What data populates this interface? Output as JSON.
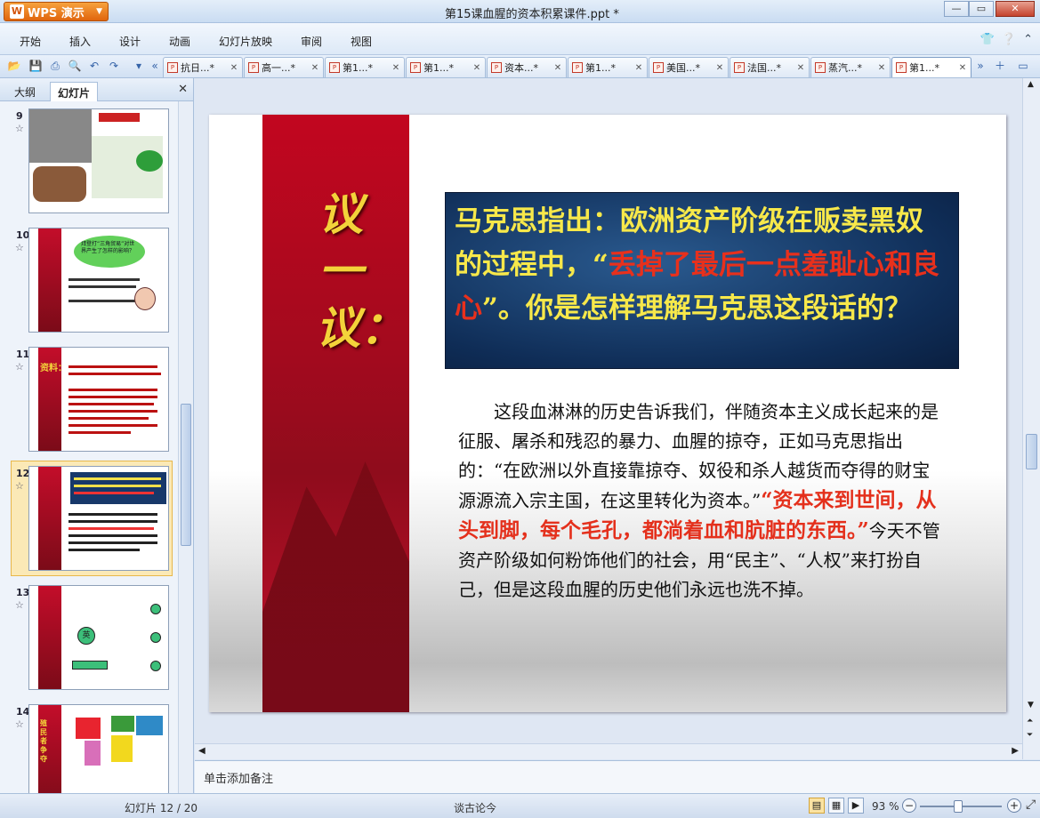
{
  "app": {
    "name": "WPS 演示",
    "document_title": "第15课血腥的资本积累课件.ppt *"
  },
  "menu": [
    "开始",
    "插入",
    "设计",
    "动画",
    "幻灯片放映",
    "审阅",
    "视图"
  ],
  "tabs": [
    "抗日...*",
    "高一...*",
    "第1...*",
    "第1...*",
    "资本...*",
    "第1...*",
    "美国...*",
    "法国...*",
    "蒸汽...*",
    "第1...*"
  ],
  "left_panel": {
    "tab_outline": "大纲",
    "tab_slides": "幻灯片",
    "thumbnails": [
      {
        "num": "9",
        "star": "☆"
      },
      {
        "num": "10",
        "star": "☆"
      },
      {
        "num": "11",
        "star": "☆"
      },
      {
        "num": "12",
        "star": "☆"
      },
      {
        "num": "13",
        "star": "☆"
      },
      {
        "num": "14",
        "star": "☆"
      }
    ],
    "thumb_texts": {
      "t10_bubble": "拜登打“三角贸易”对世界产生了怎样的影响？",
      "t11_title": "资料：",
      "t13_node": "英",
      "t14_title": "殖民者争夺"
    }
  },
  "slide": {
    "vertical_title": "议一议：",
    "quote": {
      "part1": "马克思指出：欧洲资产阶级在贩卖黑奴的过程中，“",
      "highlight": "丢掉了最后一点羞耻心和良心",
      "part2": "”。你是怎样理解马克思这段话的？"
    },
    "body": {
      "part1": "这段血淋淋的历史告诉我们，伴随资本主义成长起来的是征服、屠杀和残忍的暴力、血腥的掠夺，正如马克思指出的：“在欧洲以外直接靠掠夺、奴役和杀人越货而夺得的财宝源源流入宗主国，在这里转化为资本。”",
      "highlight": "“资本来到世间，从头到脚，每个毛孔，都淌着血和肮脏的东西。”",
      "part2": "今天不管资产阶级如何粉饰他们的社会，用“民主”、“人权”来打扮自己，但是这段血腥的历史他们永远也洗不掉。"
    }
  },
  "notes_placeholder": "单击添加备注",
  "status": {
    "slide_counter": "幻灯片 12 / 20",
    "theme": "谈古论今",
    "zoom": "93 %"
  }
}
